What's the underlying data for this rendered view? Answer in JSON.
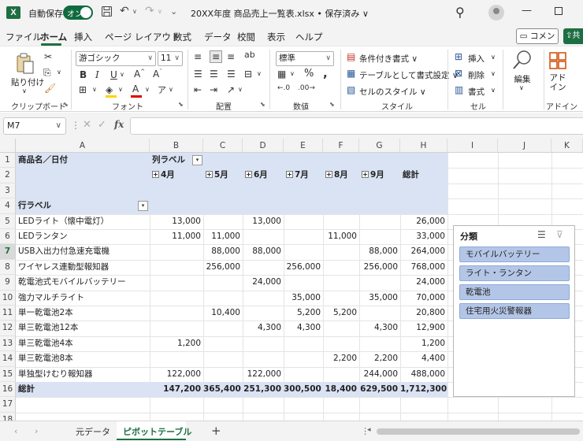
{
  "titlebar": {
    "logo": "X",
    "autosave_label": "自動保存",
    "toggle_label": "オン",
    "doc_title": "20XX年度 商品売上一覧表.xlsx • 保存済み ∨",
    "undo_icon": "undo-icon",
    "redo_icon": "redo-icon"
  },
  "tabs": [
    {
      "label": "ファイル"
    },
    {
      "label": "ホーム"
    },
    {
      "label": "挿入"
    },
    {
      "label": "ページ レイアウト"
    },
    {
      "label": "数式"
    },
    {
      "label": "データ"
    },
    {
      "label": "校閲"
    },
    {
      "label": "表示"
    },
    {
      "label": "ヘルプ"
    }
  ],
  "comment_button": "コメント",
  "share_button": "共",
  "ribbon": {
    "paste_label": "貼り付け",
    "font_name": "游ゴシック",
    "font_size": "11",
    "number_format": "標準",
    "cond_format": "条件付き書式 ∨",
    "table_format": "テーブルとして書式設定 ∨",
    "cell_style": "セルのスタイル ∨",
    "insert": "挿入",
    "delete": "削除",
    "format": "書式",
    "edit_label": "編集",
    "addin_label": "アド\nイン",
    "groups": {
      "clipboard": "クリップボード",
      "font": "フォント",
      "alignment": "配置",
      "number": "数値",
      "style": "スタイル",
      "cells": "セル",
      "addin": "アドイン"
    }
  },
  "formula_bar": {
    "name_box": "M7",
    "fx": "fx",
    "formula": ""
  },
  "columns": [
    "A",
    "B",
    "C",
    "D",
    "E",
    "F",
    "G",
    "H",
    "I",
    "J",
    "K"
  ],
  "rows": [
    "1",
    "2",
    "3",
    "4",
    "5",
    "6",
    "7",
    "8",
    "9",
    "10",
    "11",
    "12",
    "13",
    "14",
    "15",
    "16",
    "17",
    "18"
  ],
  "pivot": {
    "a1": "商品名／日付",
    "b1": "列ラベル",
    "months": [
      "4月",
      "5月",
      "6月",
      "7月",
      "8月",
      "9月"
    ],
    "total_col": "総計",
    "a4": "行ラベル",
    "items": [
      {
        "name": "LEDライト（懐中電灯）",
        "values": [
          "13,000",
          "",
          "13,000",
          "",
          "",
          "",
          "26,000"
        ]
      },
      {
        "name": "LEDランタン",
        "values": [
          "11,000",
          "11,000",
          "",
          "",
          "11,000",
          "",
          "33,000"
        ]
      },
      {
        "name": "USB入出力付急速充電機",
        "values": [
          "",
          "88,000",
          "88,000",
          "",
          "",
          "88,000",
          "264,000"
        ]
      },
      {
        "name": "ワイヤレス連動型報知器",
        "values": [
          "",
          "256,000",
          "",
          "256,000",
          "",
          "256,000",
          "768,000"
        ]
      },
      {
        "name": "乾電池式モバイルバッテリー",
        "values": [
          "",
          "",
          "24,000",
          "",
          "",
          "",
          "24,000"
        ]
      },
      {
        "name": "強力マルチライト",
        "values": [
          "",
          "",
          "",
          "35,000",
          "",
          "35,000",
          "70,000"
        ]
      },
      {
        "name": "単一乾電池2本",
        "values": [
          "",
          "10,400",
          "",
          "5,200",
          "5,200",
          "",
          "20,800"
        ]
      },
      {
        "name": "単三乾電池12本",
        "values": [
          "",
          "",
          "4,300",
          "4,300",
          "",
          "4,300",
          "12,900"
        ]
      },
      {
        "name": "単三乾電池4本",
        "values": [
          "1,200",
          "",
          "",
          "",
          "",
          "",
          "1,200"
        ]
      },
      {
        "name": "単三乾電池8本",
        "values": [
          "",
          "",
          "",
          "",
          "2,200",
          "2,200",
          "4,400"
        ]
      },
      {
        "name": "単独型けむり報知器",
        "values": [
          "122,000",
          "",
          "122,000",
          "",
          "",
          "244,000",
          "488,000"
        ]
      }
    ],
    "grand_total": {
      "name": "総計",
      "values": [
        "147,200",
        "365,400",
        "251,300",
        "300,500",
        "18,400",
        "629,500",
        "1,712,300"
      ]
    }
  },
  "slicer": {
    "title": "分類",
    "items": [
      "モバイルバッテリー",
      "ライト・ランタン",
      "乾電池",
      "住宅用火災警報器"
    ]
  },
  "sheets": {
    "tabs": [
      "元データ",
      "ピボットテーブル"
    ],
    "active": "ピボットテーブル"
  }
}
